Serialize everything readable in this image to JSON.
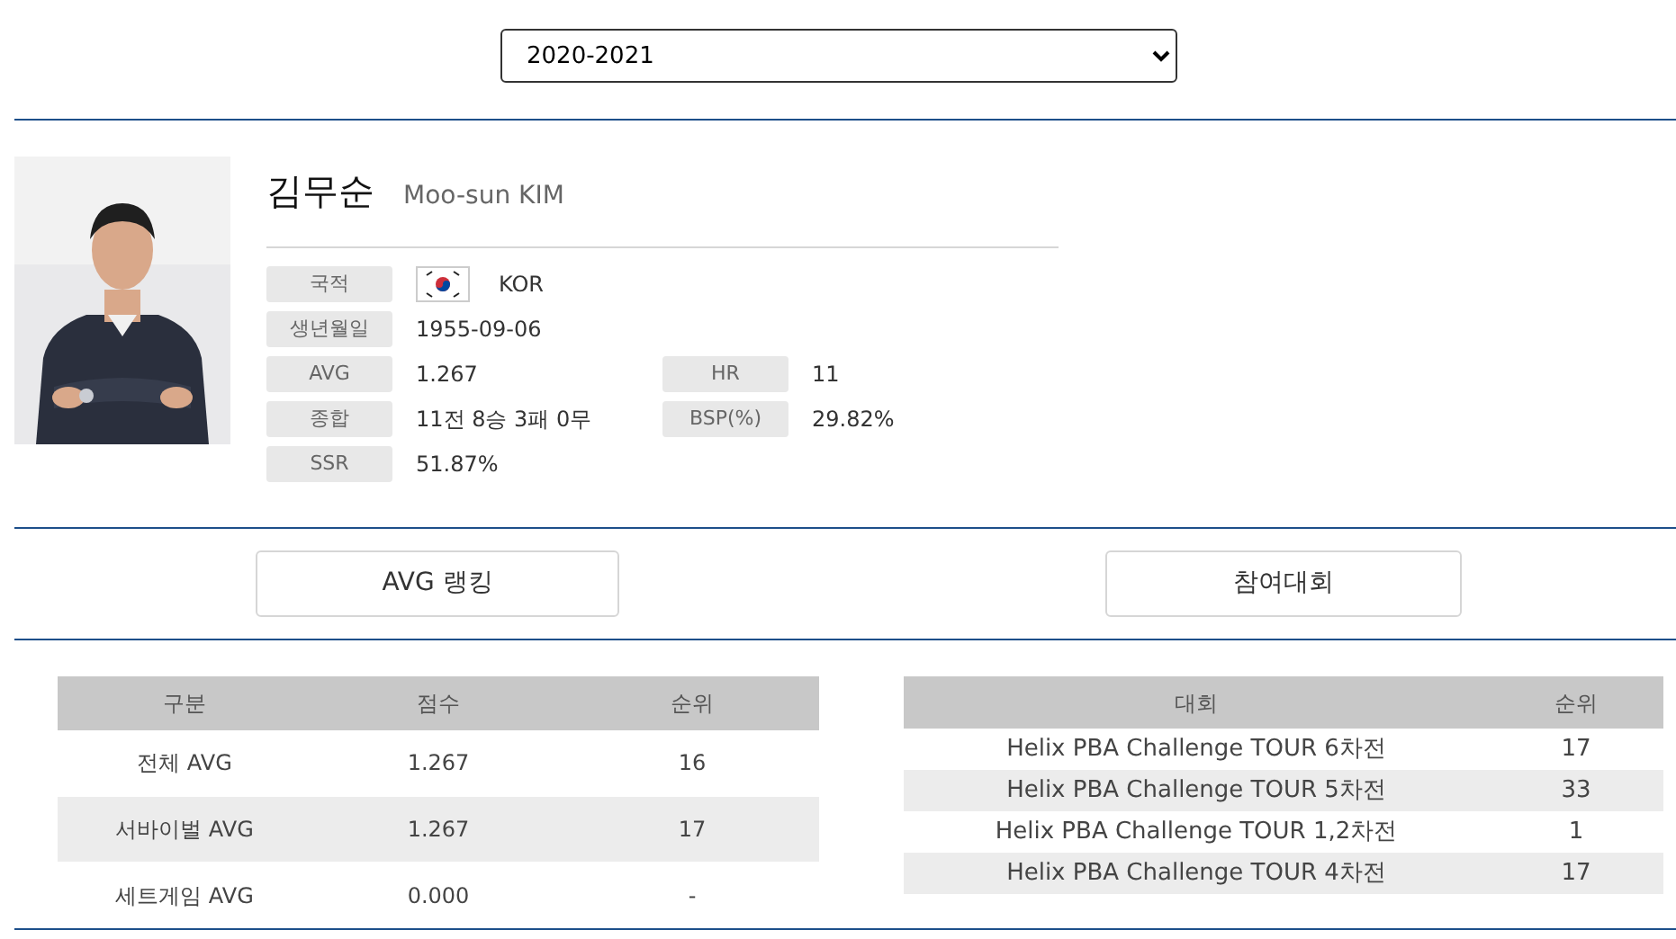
{
  "season_select": {
    "value": "2020-2021"
  },
  "player": {
    "name_ko": "김무순",
    "name_en": "Moo-sun KIM",
    "info_rows": [
      {
        "fields": [
          {
            "label": "국적",
            "value": "KOR",
            "kind": "flag"
          }
        ]
      },
      {
        "fields": [
          {
            "label": "생년월일",
            "value": "1955-09-06",
            "kind": "text"
          }
        ]
      },
      {
        "fields": [
          {
            "label": "AVG",
            "value": "1.267",
            "kind": "text"
          },
          {
            "label": "HR",
            "value": "11",
            "kind": "text"
          }
        ]
      },
      {
        "fields": [
          {
            "label": "종합",
            "value": "11전 8승 3패 0무",
            "kind": "text"
          },
          {
            "label": "BSP(%)",
            "value": "29.82%",
            "kind": "text"
          }
        ]
      },
      {
        "fields": [
          {
            "label": "SSR",
            "value": "51.87%",
            "kind": "text"
          }
        ]
      }
    ]
  },
  "buttons": [
    "AVG 랭킹",
    "참여대회"
  ],
  "ranking_table": {
    "columns": [
      "구분",
      "점수",
      "순위"
    ],
    "rows": [
      [
        "전체 AVG",
        "1.267",
        "16"
      ],
      [
        "서바이벌 AVG",
        "1.267",
        "17"
      ],
      [
        "세트게임 AVG",
        "0.000",
        "-"
      ]
    ]
  },
  "tournament_table": {
    "columns": [
      "대회",
      "순위"
    ],
    "rows": [
      [
        "Helix PBA Challenge TOUR 6차전",
        "17"
      ],
      [
        "Helix PBA Challenge TOUR 5차전",
        "33"
      ],
      [
        "Helix PBA Challenge TOUR 1,2차전",
        "1"
      ],
      [
        "Helix PBA Challenge TOUR 4차전",
        "17"
      ]
    ]
  }
}
